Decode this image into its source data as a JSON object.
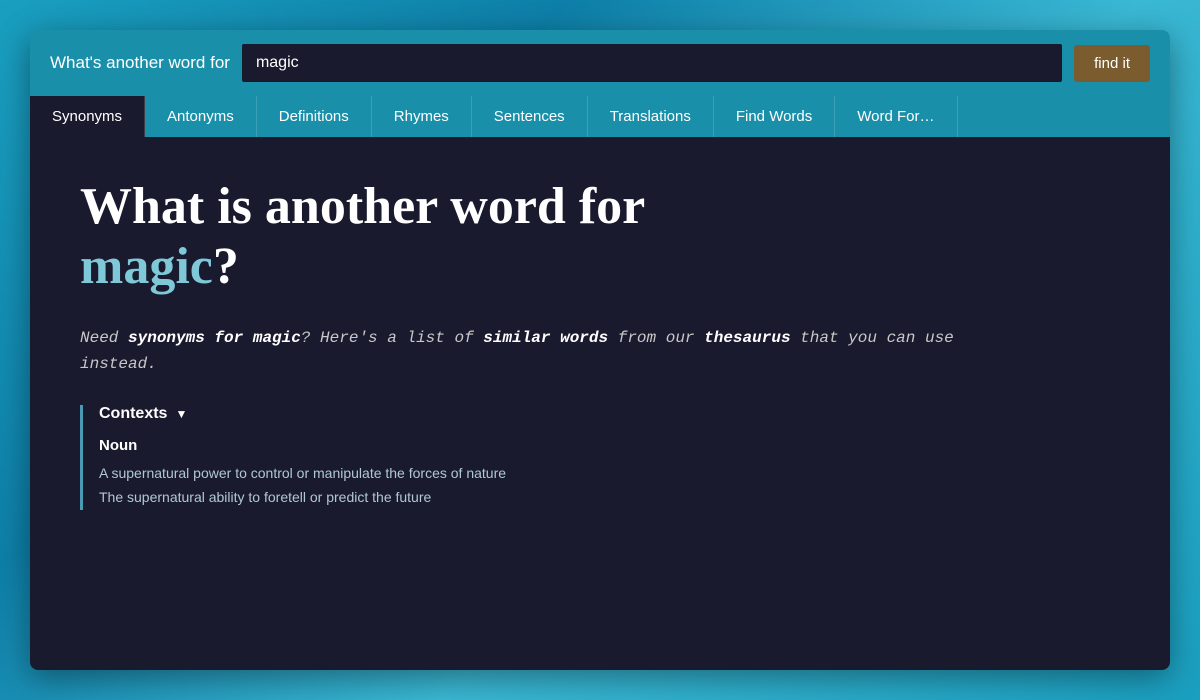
{
  "header": {
    "label": "What's another word for",
    "search_value": "magic",
    "find_button_label": "find it"
  },
  "nav": {
    "tabs": [
      {
        "id": "synonyms",
        "label": "Synonyms",
        "active": true
      },
      {
        "id": "antonyms",
        "label": "Antonyms",
        "active": false
      },
      {
        "id": "definitions",
        "label": "Definitions",
        "active": false
      },
      {
        "id": "rhymes",
        "label": "Rhymes",
        "active": false
      },
      {
        "id": "sentences",
        "label": "Sentences",
        "active": false
      },
      {
        "id": "translations",
        "label": "Translations",
        "active": false
      },
      {
        "id": "find-words",
        "label": "Find Words",
        "active": false
      },
      {
        "id": "word-forms",
        "label": "Word For…",
        "active": false
      }
    ]
  },
  "main": {
    "title_prefix": "What is another word for",
    "title_word": "magic",
    "title_suffix": "?",
    "description_html": "Need <b><i>synonyms for magic</i></b>? Here's a list of <b><i>similar words</i></b> from our <b><i>thesaurus</i></b> <i>that you can use instead.</i>",
    "contexts_label": "Contexts",
    "contexts_arrow": "▼",
    "noun_label": "Noun",
    "context_items": [
      "A supernatural power to control or manipulate the forces of nature",
      "The supernatural ability to foretell or predict the future"
    ]
  },
  "colors": {
    "background": "#1a1a2e",
    "header_bg": "#1a8faa",
    "find_button_bg": "#7a5c2e",
    "title_color": "#ffffff",
    "word_color": "#7ec8d8",
    "text_color": "#c8c8c8"
  }
}
